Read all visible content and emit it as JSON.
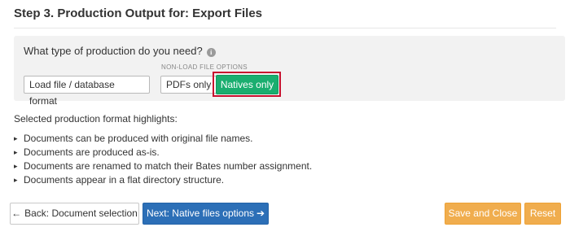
{
  "step": {
    "title": "Step 3. Production Output for: Export Files"
  },
  "panel": {
    "question": "What type of production do you need?",
    "info_icon": "info-circle-icon",
    "non_load_label": "NON-LOAD FILE OPTIONS",
    "options": {
      "load": "Load file / database format",
      "pdf": "PDFs only",
      "natives": "Natives only"
    },
    "selected_option": "Natives only",
    "selected_color": "#1aae6f",
    "highlight_outline_color": "#c8102e"
  },
  "highlights": {
    "heading": "Selected production format highlights:",
    "items": [
      "Documents can be produced with original file names.",
      "Documents are produced as-is.",
      "Documents are renamed to match their Bates number assignment.",
      "Documents appear in a flat directory structure."
    ]
  },
  "footer": {
    "back_label": "Back: Document selection",
    "back_icon": "arrow-left-icon",
    "next_label": "Next: Native files options",
    "next_icon": "arrow-right-icon",
    "save_label": "Save and Close",
    "reset_label": "Reset",
    "colors": {
      "primary": "#2c6fb7",
      "warning": "#f0ad4e"
    }
  }
}
